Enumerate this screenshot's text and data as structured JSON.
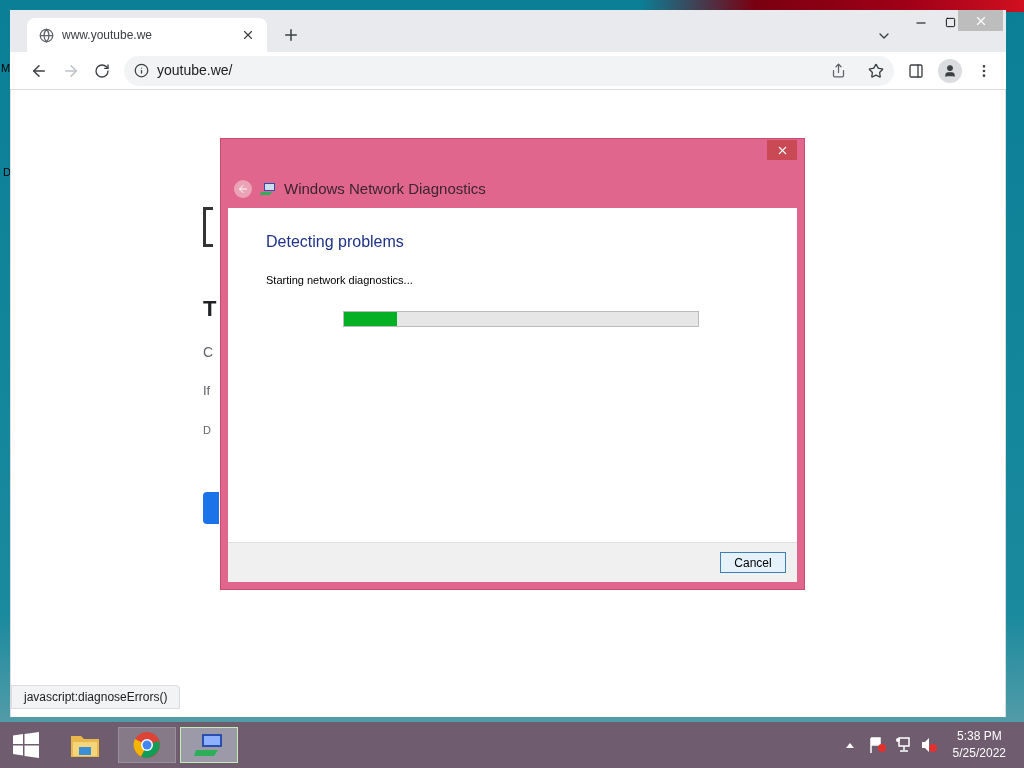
{
  "desktop_fragments": [
    "M",
    "D"
  ],
  "browser": {
    "tab": {
      "title": "www.youtube.we",
      "selected": true
    },
    "address": "youtube.we/",
    "page_fragments": [
      "T",
      "C",
      "If",
      "D"
    ],
    "status_link": "javascript:diagnoseErrors()"
  },
  "dialog": {
    "title": "Windows Network Diagnostics",
    "heading": "Detecting problems",
    "message": "Starting network diagnostics...",
    "progress": {
      "level": 0.15
    },
    "buttons": [
      "Cancel"
    ]
  },
  "taskbar": {
    "apps": [
      {
        "kind": "explorer",
        "selected": false
      },
      {
        "kind": "chrome",
        "selected": true
      },
      {
        "kind": "diagnostics",
        "selected": true
      }
    ],
    "time": "5:38 PM",
    "date": "5/25/2022"
  }
}
